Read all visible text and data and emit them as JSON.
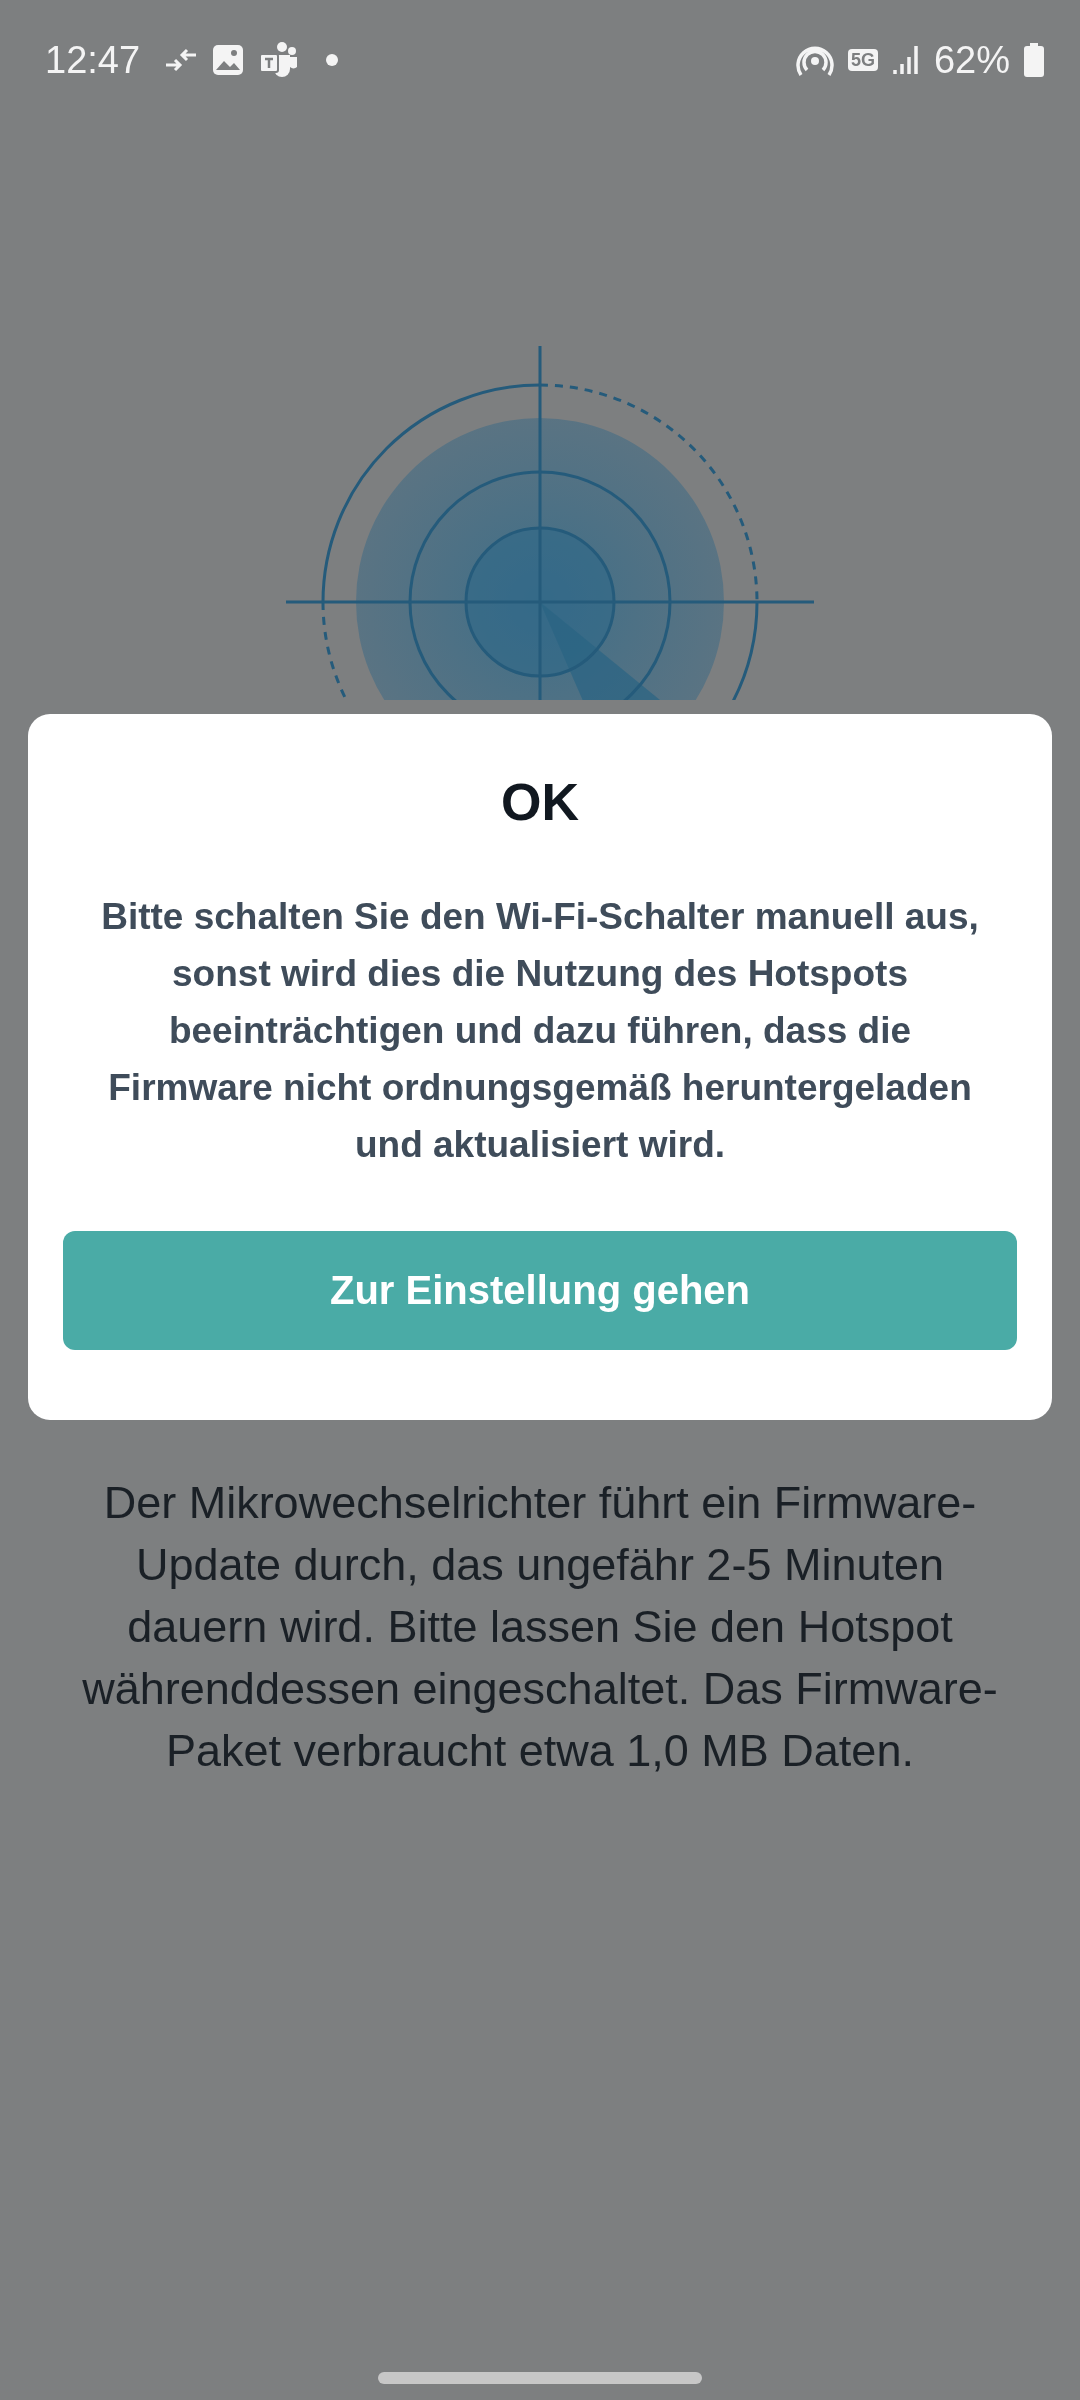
{
  "status_bar": {
    "time": "12:47",
    "network_type": "5G",
    "battery": "62%"
  },
  "description": "Der Mikrowechselrichter führt ein Firmware-Update durch, das ungefähr 2-5 Minuten dauern wird. Bitte lassen Sie den Hotspot währenddessen eingeschaltet. Das Firmware-Paket verbraucht etwa 1,0 MB Daten.",
  "dialog": {
    "title": "OK",
    "message": "Bitte schalten Sie den Wi-Fi-Schalter manuell aus, sonst wird dies die Nutzung des Hotspots beeinträchtigen und dazu führen, dass die Firmware nicht ordnungsgemäß heruntergeladen und aktualisiert wird.",
    "button": "Zur Einstellung gehen"
  }
}
